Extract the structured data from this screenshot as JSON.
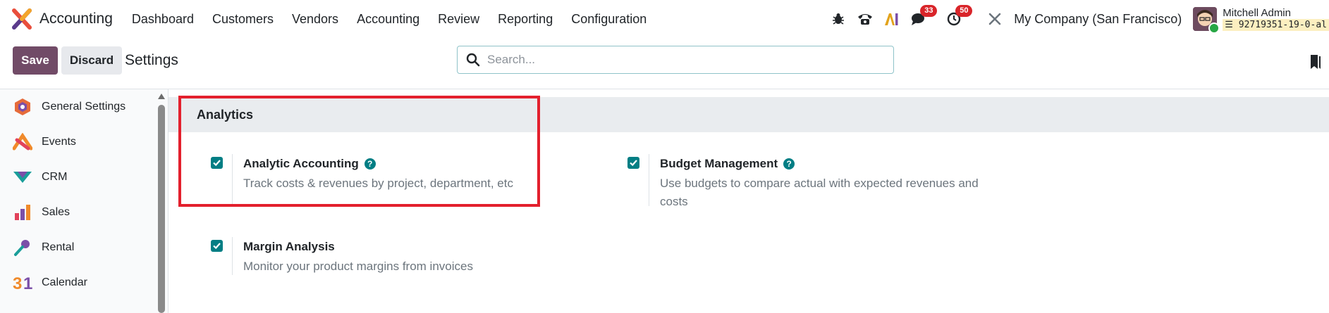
{
  "navbar": {
    "app_name": "Accounting",
    "menu": [
      "Dashboard",
      "Customers",
      "Vendors",
      "Accounting",
      "Review",
      "Reporting",
      "Configuration"
    ],
    "messages_count": "33",
    "activities_count": "50",
    "company": "My Company (San Francisco)",
    "user_name": "Mitchell Admin",
    "db_name": "92719351-19-0-al"
  },
  "control_panel": {
    "save_label": "Save",
    "discard_label": "Discard",
    "title": "Settings",
    "search_placeholder": "Search..."
  },
  "sidebar": {
    "items": [
      {
        "label": "General Settings",
        "icon": "general-settings-icon"
      },
      {
        "label": "Events",
        "icon": "events-icon"
      },
      {
        "label": "CRM",
        "icon": "crm-icon"
      },
      {
        "label": "Sales",
        "icon": "sales-icon"
      },
      {
        "label": "Rental",
        "icon": "rental-icon"
      },
      {
        "label": "Calendar",
        "icon": "calendar-icon"
      }
    ]
  },
  "section": {
    "title": "Analytics",
    "settings": [
      {
        "title": "Analytic Accounting",
        "description": "Track costs & revenues by project, department, etc",
        "checked": true
      },
      {
        "title": "Budget Management",
        "description_line1": "Use budgets to compare actual with expected revenues and",
        "description_line2": "costs",
        "checked": true
      },
      {
        "title": "Margin Analysis",
        "description": "Monitor your product margins from invoices",
        "checked": true
      }
    ]
  },
  "colors": {
    "brand": "#714b67",
    "teal": "#017e84",
    "highlight": "#e3202d",
    "badge": "#d9252a"
  }
}
